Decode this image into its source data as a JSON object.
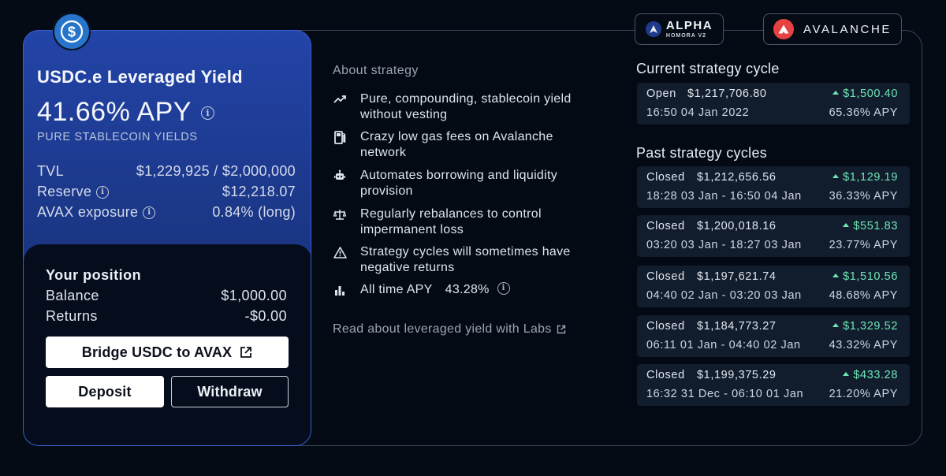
{
  "brands": {
    "alpha_main": "ALPHA",
    "alpha_sub": "HOMORA V2",
    "avalanche": "AVALANCHE"
  },
  "card": {
    "title": "USDC.e Leveraged Yield",
    "apy": "41.66% APY",
    "subtitle": "PURE STABLECOIN YIELDS",
    "stats": [
      {
        "label": "TVL",
        "value": "$1,229,925 / $2,000,000"
      },
      {
        "label": "Reserve",
        "value": "$12,218.07"
      },
      {
        "label": "AVAX exposure",
        "value": "0.84% (long)"
      }
    ]
  },
  "position": {
    "title": "Your position",
    "balance_label": "Balance",
    "balance_value": "$1,000.00",
    "returns_label": "Returns",
    "returns_value": "-$0.00",
    "bridge_label": "Bridge USDC to AVAX",
    "deposit_label": "Deposit",
    "withdraw_label": "Withdraw"
  },
  "about": {
    "heading": "About strategy",
    "features": [
      {
        "icon": "trending-up-icon",
        "text": "Pure, compounding, stablecoin yield without vesting"
      },
      {
        "icon": "gas-pump-icon",
        "text": "Crazy low gas fees on Avalanche network"
      },
      {
        "icon": "robot-icon",
        "text": "Automates borrowing and liquidity provision"
      },
      {
        "icon": "scale-icon",
        "text": "Regularly rebalances to control impermanent loss"
      },
      {
        "icon": "warning-icon",
        "text": "Strategy cycles will sometimes have negative returns"
      }
    ],
    "all_time_label": "All time APY",
    "all_time_value": "43.28%",
    "labs_link": "Read about leveraged yield with Labs"
  },
  "current": {
    "title": "Current strategy cycle",
    "status": "Open",
    "amount": "$1,217,706.80",
    "gain": "$1,500.40",
    "date": "16:50 04 Jan 2022",
    "apy": "65.36% APY"
  },
  "past": {
    "title": "Past strategy cycles",
    "cycles": [
      {
        "status": "Closed",
        "amount": "$1,212,656.56",
        "gain": "$1,129.19",
        "range": "18:28 03 Jan - 16:50 04 Jan",
        "apy": "36.33% APY"
      },
      {
        "status": "Closed",
        "amount": "$1,200,018.16",
        "gain": "$551.83",
        "range": "03:20 03 Jan - 18:27 03 Jan",
        "apy": "23.77% APY"
      },
      {
        "status": "Closed",
        "amount": "$1,197,621.74",
        "gain": "$1,510.56",
        "range": "04:40 02 Jan - 03:20 03 Jan",
        "apy": "48.68% APY"
      },
      {
        "status": "Closed",
        "amount": "$1,184,773.27",
        "gain": "$1,329.52",
        "range": "06:11 01 Jan - 04:40 02 Jan",
        "apy": "43.32% APY"
      },
      {
        "status": "Closed",
        "amount": "$1,199,375.29",
        "gain": "$433.28",
        "range": "16:32 31 Dec - 06:10 01 Jan",
        "apy": "21.20% APY"
      }
    ]
  },
  "colors": {
    "card_blue": "#2344a8",
    "gain_green": "#6ee7b7",
    "usdc_blue": "#2775ca",
    "avax_red": "#e84142"
  }
}
